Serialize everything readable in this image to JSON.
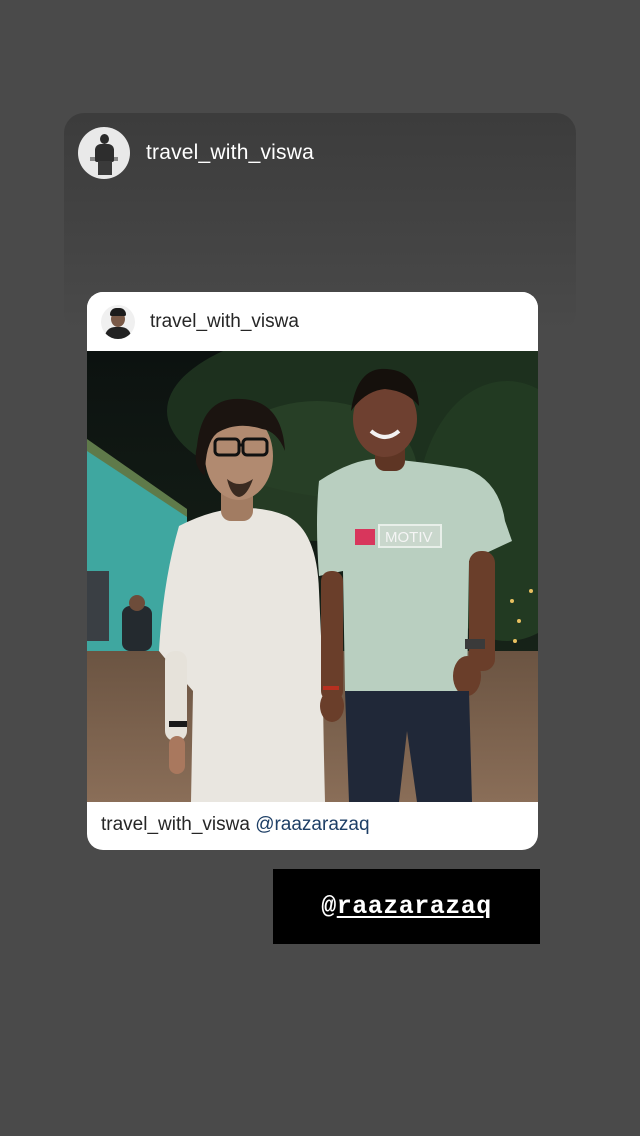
{
  "story": {
    "username": "travel_with_viswa"
  },
  "post": {
    "username": "travel_with_viswa",
    "caption_user": "travel_with_viswa",
    "caption_mention": "@raazarazaq",
    "photo_shirt_text": "MOTIV"
  },
  "sticker": {
    "at": "@",
    "handle": "raazarazaq"
  },
  "icons": {
    "story_avatar": "profile-avatar",
    "post_avatar": "profile-avatar"
  },
  "colors": {
    "background": "#4a4a4a",
    "card": "#ffffff",
    "mention_link": "#1e3f66",
    "sticker_bg": "#000000"
  }
}
